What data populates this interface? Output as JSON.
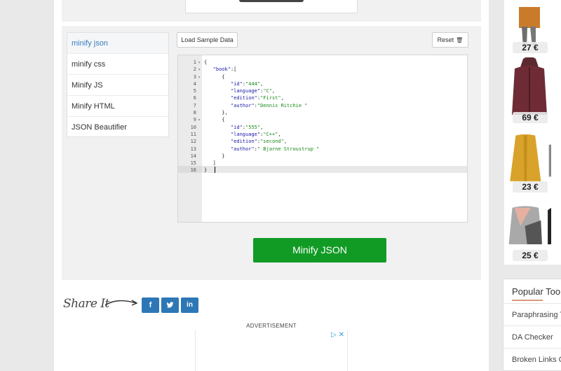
{
  "menu": {
    "items": [
      {
        "label": "minify json",
        "active": true
      },
      {
        "label": "minify css"
      },
      {
        "label": "Minify JS"
      },
      {
        "label": "Minify HTML"
      },
      {
        "label": "JSON Beautifier"
      }
    ]
  },
  "toolbar": {
    "load_sample_label": "Load Sample Data",
    "reset_label": "Reset",
    "reset_icon": "trash-icon"
  },
  "editor": {
    "lines": [
      {
        "n": "1",
        "fold": true,
        "text": "{"
      },
      {
        "n": "2",
        "fold": true,
        "text": "   \"book\":["
      },
      {
        "n": "3",
        "fold": true,
        "text": "      {"
      },
      {
        "n": "4",
        "text": "         \"id\":\"444\","
      },
      {
        "n": "5",
        "text": "         \"language\":\"C\","
      },
      {
        "n": "6",
        "text": "         \"edition\":\"First\","
      },
      {
        "n": "7",
        "text": "         \"author\":\"Dennis Ritchie \""
      },
      {
        "n": "8",
        "text": "      },"
      },
      {
        "n": "9",
        "fold": true,
        "text": "      {"
      },
      {
        "n": "10",
        "text": "         \"id\":\"555\","
      },
      {
        "n": "11",
        "text": "         \"language\":\"C++\","
      },
      {
        "n": "12",
        "text": "         \"edition\":\"second\","
      },
      {
        "n": "13",
        "text": "         \"author\":\" Bjarne Stroustrup \""
      },
      {
        "n": "14",
        "text": "      }"
      },
      {
        "n": "15",
        "text": "   ]"
      },
      {
        "n": "16",
        "text": "}"
      }
    ]
  },
  "action": {
    "minify_label": "Minify JSON",
    "color": "#119b25"
  },
  "share": {
    "label": "Share It",
    "buttons": [
      {
        "name": "facebook",
        "glyph": "f"
      },
      {
        "name": "twitter",
        "glyph": "t"
      },
      {
        "name": "linkedin",
        "glyph": "in"
      }
    ]
  },
  "ad": {
    "label": "ADVERTISEMENT"
  },
  "products": [
    {
      "price": "27 €"
    },
    {
      "price": "69 €"
    },
    {
      "price": "23 €"
    },
    {
      "price": "25 €"
    }
  ],
  "popular": {
    "title": "Popular Tools",
    "items": [
      {
        "label": "Paraphrasing Tool"
      },
      {
        "label": "DA Checker"
      },
      {
        "label": "Broken Links Checker"
      }
    ]
  }
}
